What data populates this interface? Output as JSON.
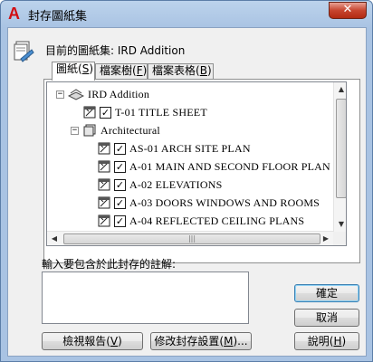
{
  "window": {
    "title": "封存圖紙集",
    "close_glyph": "✕"
  },
  "target": {
    "label": "目前的圖紙集: IRD Addition"
  },
  "tabs": [
    {
      "label": "圖紙",
      "hotkey": "S"
    },
    {
      "label": "檔案樹",
      "hotkey": "F"
    },
    {
      "label": "檔案表格",
      "hotkey": "B"
    }
  ],
  "tree": {
    "root": "IRD Addition",
    "items": [
      {
        "label": "T-01 TITLE SHEET",
        "checked": true
      },
      {
        "label": "Architectural",
        "group": true
      },
      {
        "label": "AS-01 ARCH SITE PLAN",
        "checked": true
      },
      {
        "label": "A-01 MAIN AND SECOND FLOOR PLAN",
        "checked": true
      },
      {
        "label": "A-02 ELEVATIONS",
        "checked": true
      },
      {
        "label": "A-03 DOORS WINDOWS AND ROOMS",
        "checked": true
      },
      {
        "label": "A-04 REFLECTED CEILING PLANS",
        "checked": true
      }
    ]
  },
  "scroll_glyphs": {
    "up": "▲",
    "down": "▼",
    "left": "◀",
    "right": "▶",
    "grip": "|||"
  },
  "expander_glyphs": {
    "minus": "−"
  },
  "check_glyph": "✓",
  "notes": {
    "label": "輸入要包含於此封存的註解:",
    "value": ""
  },
  "buttons": {
    "view_report": {
      "label": "檢視報告",
      "hotkey": "V"
    },
    "modify_setup": {
      "label": "修改封存設置",
      "suffix": "...",
      "hotkey": "M"
    },
    "ok": {
      "label": "確定"
    },
    "cancel": {
      "label": "取消"
    },
    "help": {
      "label": "說明",
      "hotkey": "H"
    }
  },
  "colors": {
    "accent_red": "#d10f13",
    "selection_blue": "#3c7fb1"
  }
}
